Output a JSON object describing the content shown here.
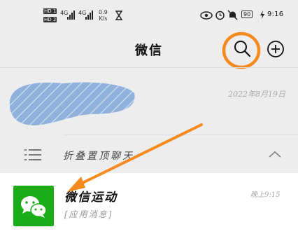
{
  "status_bar": {
    "hd1": "HD 1",
    "hd2": "HD 2",
    "net1": "4G",
    "net2": "4G",
    "speed_value": "0.9",
    "speed_unit": "K/s",
    "battery": "90",
    "time": "9:16"
  },
  "header": {
    "title": "微信"
  },
  "conversations": [
    {
      "date": "2022年8月19日"
    }
  ],
  "folded": {
    "label": "折叠置顶聊天"
  },
  "chat": {
    "title": "微信运动",
    "subtitle": "[应用消息]",
    "time": "晚上9:15"
  },
  "colors": {
    "background": "#ededed",
    "brand_green": "#1aad19",
    "annotation_orange": "#f58a1f",
    "scribble_blue": "#8fb1dc"
  }
}
